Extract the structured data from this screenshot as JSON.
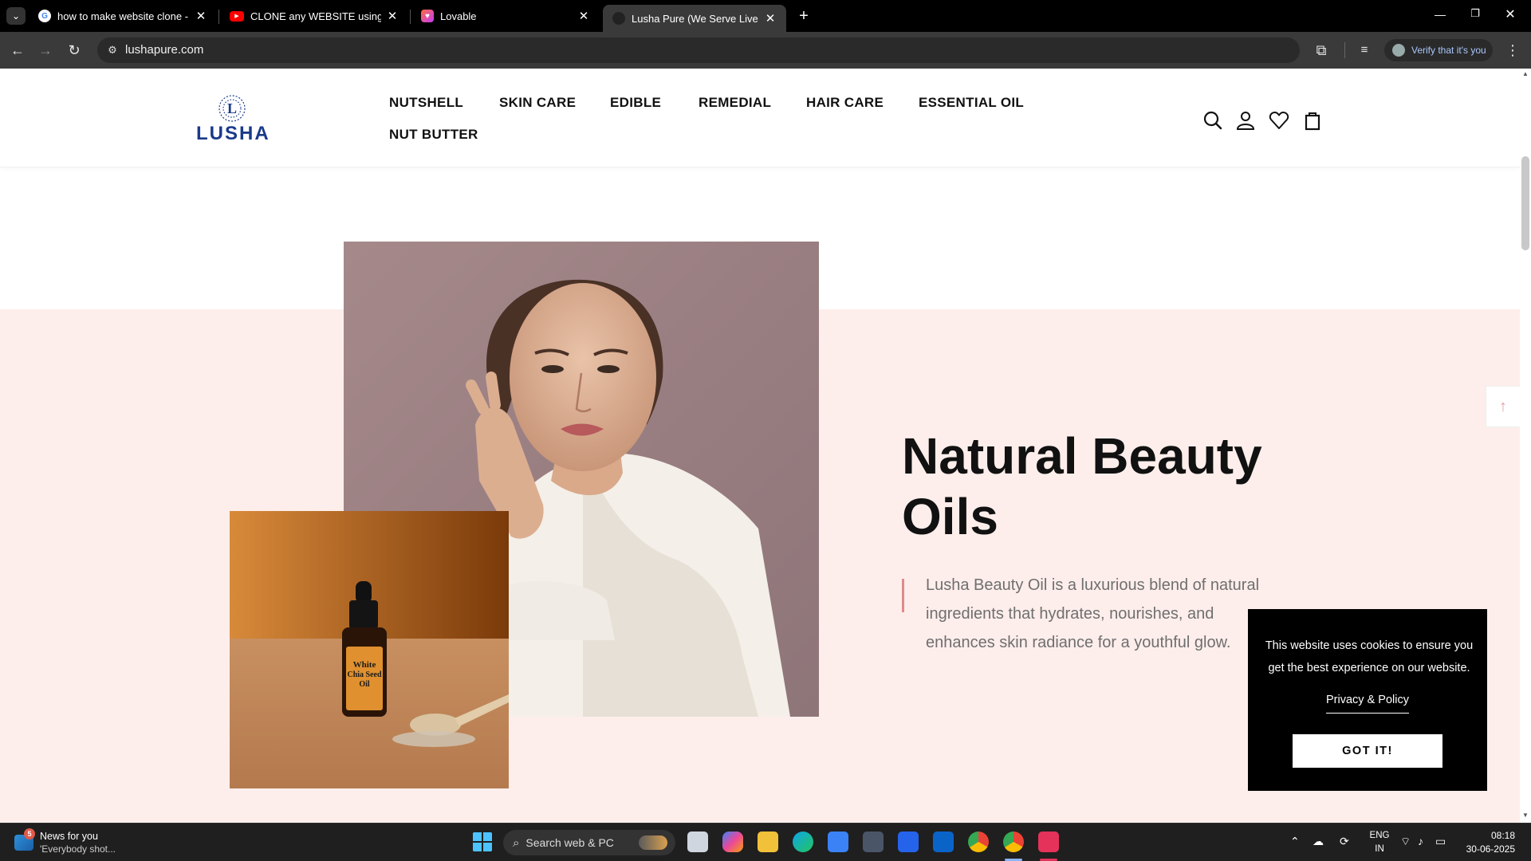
{
  "browser": {
    "tabs": [
      {
        "title": "how to make website clone - G",
        "icon": "google-icon"
      },
      {
        "title": "CLONE any WEBSITE using AI -",
        "icon": "youtube-icon"
      },
      {
        "title": "Lovable",
        "icon": "lovable-icon"
      },
      {
        "title": "Lusha Pure (We Serve Live & Pu",
        "icon": "lusha-icon"
      }
    ],
    "url": "lushapure.com",
    "verify_label": "Verify that it's you"
  },
  "site": {
    "logo_text": "LUSHA",
    "nav": [
      "NUTSHELL",
      "SKIN CARE",
      "EDIBLE",
      "REMEDIAL",
      "HAIR CARE",
      "ESSENTIAL OIL",
      "NUT BUTTER"
    ]
  },
  "hero": {
    "heading_line1": "Natural Beauty",
    "heading_line2": "Oils",
    "description": "Lusha Beauty Oil is a luxurious blend of natural ingredients that hydrates, nourishes, and enhances skin radiance for a youthful glow.",
    "product_label": {
      "line1": "White",
      "line2": "Chia Seed",
      "line3": "Oil"
    }
  },
  "cookie": {
    "text": "This website uses cookies to ensure you get the best experience on our website.",
    "link": "Privacy & Policy",
    "button": "GOT IT!"
  },
  "taskbar": {
    "news_title": "News for you",
    "news_sub": "'Everybody shot...",
    "news_badge": "5",
    "search_placeholder": "Search web & PC",
    "lang_line1": "ENG",
    "lang_line2": "IN",
    "time": "08:18",
    "date": "30-06-2025"
  }
}
